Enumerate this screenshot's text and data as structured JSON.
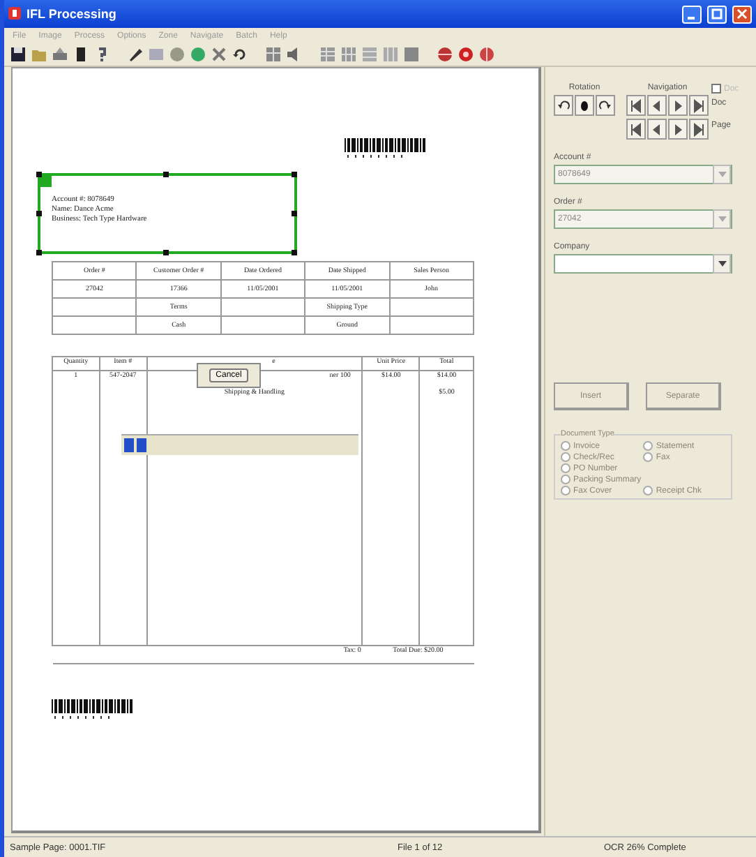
{
  "window": {
    "title": "IFL Processing"
  },
  "menu": [
    "File",
    "Image",
    "Process",
    "Options",
    "Zone",
    "Navigate",
    "Batch",
    "Help"
  ],
  "document": {
    "account_block": {
      "selected": true,
      "lines": [
        "Account #: 8078649",
        "Name: Dance Acme",
        "Business: Tech Type Hardware"
      ]
    },
    "order_table": {
      "rows": [
        [
          "Order #",
          "Customer Order #",
          "Date Ordered",
          "Date Shipped",
          "Sales Person"
        ],
        [
          "27042",
          "17366",
          "11/05/2001",
          "11/05/2001",
          "John"
        ],
        [
          "",
          "Terms",
          "",
          "Shipping Type",
          ""
        ],
        [
          "",
          "Cash",
          "",
          "Ground",
          ""
        ]
      ]
    },
    "items_table": {
      "columns": [
        "Quantity",
        "Item #",
        "e",
        "Unit Price",
        "Total"
      ],
      "rows": [
        [
          "1",
          "547-2047",
          "ner 100",
          "$14.00",
          "$14.00"
        ],
        [
          "",
          "",
          "Shipping & Handling",
          "",
          "$5.00"
        ]
      ],
      "footer": [
        "Tax: 0",
        "Total Due: $20.00"
      ]
    },
    "cancel_dialog": {
      "button": "Cancel"
    },
    "progress": {
      "level": 0.1
    }
  },
  "side_panel": {
    "rotation_label": "Rotation",
    "navigation_label": "Navigation",
    "nav_checkbox": {
      "label": "Doc",
      "checked": false
    },
    "nav_rows": [
      "Doc",
      "Page"
    ],
    "fields": [
      {
        "label": "Account #",
        "value": "8078649",
        "disabled": true
      },
      {
        "label": "Order #",
        "value": "27042",
        "disabled": true
      },
      {
        "label": "Company",
        "disabled": false
      }
    ],
    "buttons": [
      {
        "label": "Insert",
        "disabled": true
      },
      {
        "label": "Separate",
        "disabled": true
      }
    ],
    "doc_type": {
      "title": "Document Type",
      "options": [
        {
          "label": "Invoice",
          "selected": false
        },
        {
          "label": "Statement",
          "selected": false
        },
        {
          "label": "Check/Rec",
          "selected": false
        },
        {
          "label": "Fax",
          "selected": false
        },
        {
          "label": "PO Number",
          "selected": false
        },
        {
          "label": "Packing Summary",
          "selected": false
        },
        {
          "label": "Fax Cover",
          "selected": false
        },
        {
          "label": "Receipt Chk",
          "selected": false
        }
      ]
    }
  },
  "status_bar": [
    "Sample Page: 0001.TIF",
    "File 1 of 12",
    "OCR 26% Complete"
  ]
}
